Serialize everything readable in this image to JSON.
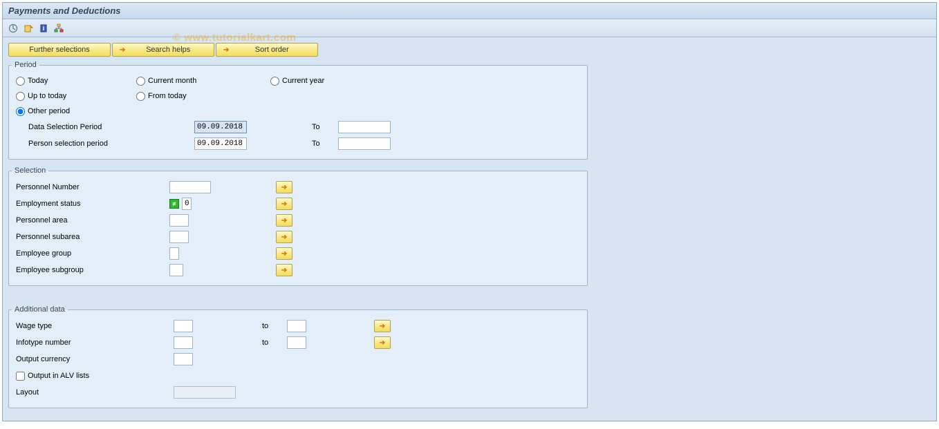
{
  "title": "Payments and Deductions",
  "watermark": "© www.tutorialkart.com",
  "toolbar_buttons": {
    "further_selections": "Further selections",
    "search_helps": "Search helps",
    "sort_order": "Sort order"
  },
  "period": {
    "legend": "Period",
    "radios": {
      "today": "Today",
      "current_month": "Current month",
      "current_year": "Current year",
      "up_to_today": "Up to today",
      "from_today": "From today",
      "other_period": "Other period"
    },
    "selected": "other_period",
    "data_selection_label": "Data Selection Period",
    "person_selection_label": "Person selection period",
    "to_label": "To",
    "data_selection_from": "09.09.2018",
    "data_selection_to": "",
    "person_selection_from": "09.09.2018",
    "person_selection_to": ""
  },
  "selection": {
    "legend": "Selection",
    "personnel_number": {
      "label": "Personnel Number",
      "value": ""
    },
    "employment_status": {
      "label": "Employment status",
      "value": "0"
    },
    "personnel_area": {
      "label": "Personnel area",
      "value": ""
    },
    "personnel_subarea": {
      "label": "Personnel subarea",
      "value": ""
    },
    "employee_group": {
      "label": "Employee group",
      "value": ""
    },
    "employee_subgroup": {
      "label": "Employee subgroup",
      "value": ""
    }
  },
  "additional": {
    "legend": "Additional data",
    "wage_type": {
      "label": "Wage type",
      "to_label": "to",
      "from": "",
      "to": ""
    },
    "infotype_number": {
      "label": "Infotype number",
      "to_label": "to",
      "from": "",
      "to": ""
    },
    "output_currency": {
      "label": "Output currency",
      "value": ""
    },
    "output_alv": {
      "label": "Output in ALV lists",
      "checked": false
    },
    "layout": {
      "label": "Layout",
      "value": ""
    }
  }
}
